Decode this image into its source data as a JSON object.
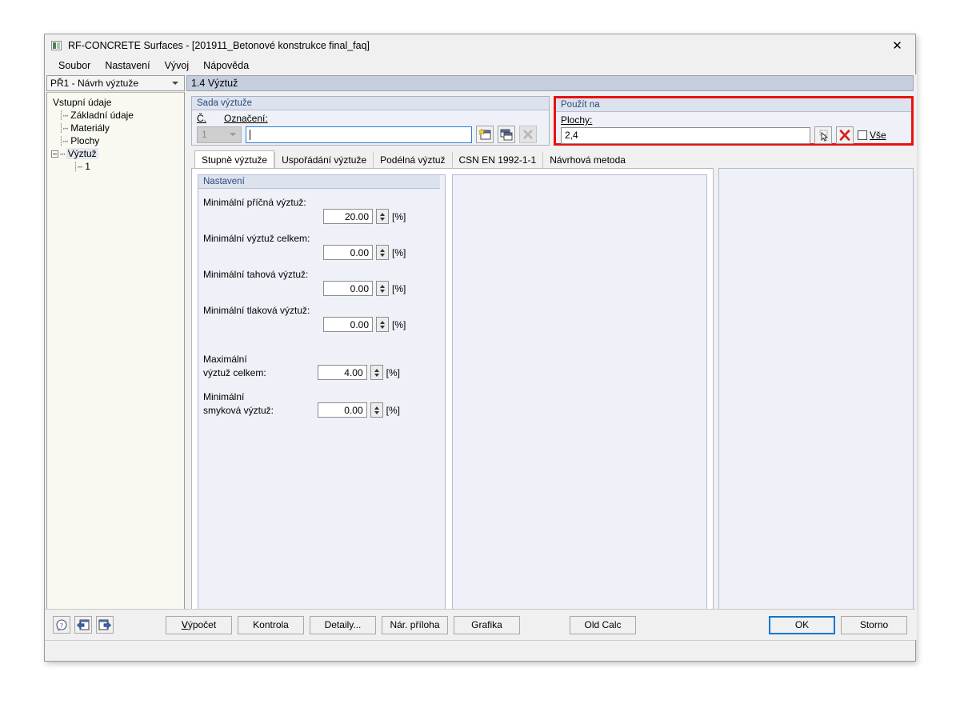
{
  "window": {
    "title": "RF-CONCRETE Surfaces - [201911_Betonové konstrukce final_faq]",
    "app_icon": "application-icon",
    "close_label": "✕"
  },
  "menubar": {
    "items": [
      {
        "label": "Soubor"
      },
      {
        "label": "Nastavení"
      },
      {
        "label": "Vývoj"
      },
      {
        "label": "Nápověda"
      }
    ]
  },
  "sidebar": {
    "combo_value": "PŘ1 - Návrh výztuže",
    "tree": [
      {
        "label": "Vstupní údaje",
        "indent": 0,
        "selected": false,
        "expander": false,
        "dash": false
      },
      {
        "label": "Základní údaje",
        "indent": 1,
        "selected": false,
        "expander": false,
        "dash": true
      },
      {
        "label": "Materiály",
        "indent": 1,
        "selected": false,
        "expander": false,
        "dash": true
      },
      {
        "label": "Plochy",
        "indent": 1,
        "selected": false,
        "expander": false,
        "dash": true
      },
      {
        "label": "Výztuž",
        "indent": 1,
        "selected": true,
        "expander": true,
        "dash": true
      },
      {
        "label": "1",
        "indent": 2,
        "selected": false,
        "expander": false,
        "dash": true
      }
    ]
  },
  "section": {
    "header": "1.4 Výztuž"
  },
  "sada": {
    "title": "Sada výztuže",
    "number_label": "Č.",
    "number_value": "1",
    "name_label": "Označení:",
    "name_value": "",
    "name_placeholder": "",
    "buttons": [
      {
        "name": "new-reinforcement-set-button",
        "icon": "new-window-icon"
      },
      {
        "name": "copy-reinforcement-set-button",
        "icon": "copy-window-icon"
      },
      {
        "name": "delete-reinforcement-set-button",
        "icon": "delete-x-icon"
      }
    ]
  },
  "pouzit": {
    "title": "Použít na",
    "surfaces_label": "Plochy:",
    "surfaces_value": "2,4",
    "pick_icon": "pick-pointer-icon",
    "clear_icon": "red-x-icon",
    "all_checkbox_label": "Vše",
    "all_checkbox_checked": false,
    "highlight_color": "#e81111"
  },
  "tabs": [
    {
      "label": "Stupně výztuže",
      "active": true
    },
    {
      "label": "Uspořádání výztuže",
      "active": false
    },
    {
      "label": "Podélná výztuž",
      "active": false
    },
    {
      "label": "CSN EN 1992-1-1",
      "active": false
    },
    {
      "label": "Návrhová metoda",
      "active": false
    }
  ],
  "settings": {
    "title": "Nastavení",
    "fields": [
      {
        "label": "Minimální příčná výztuž:",
        "label2": "",
        "value": "20.00",
        "unit": "[%]"
      },
      {
        "label": "Minimální výztuž celkem:",
        "label2": "",
        "value": "0.00",
        "unit": "[%]"
      },
      {
        "label": "Minimální tahová výztuž:",
        "label2": "",
        "value": "0.00",
        "unit": "[%]"
      },
      {
        "label": "Minimální tlaková výztuž:",
        "label2": "",
        "value": "0.00",
        "unit": "[%]"
      },
      {
        "label": "Maximální",
        "label2": "výztuž celkem:",
        "value": "4.00",
        "unit": "[%]"
      },
      {
        "label": "Minimální",
        "label2": "smyková výztuž:",
        "value": "0.00",
        "unit": "[%]"
      }
    ]
  },
  "graphic_panel": {
    "tool_icons": [
      {
        "name": "render-view-icon"
      },
      {
        "name": "render-view-alt-icon"
      }
    ]
  },
  "bottombar": {
    "icons": [
      {
        "name": "help-icon"
      },
      {
        "name": "previous-module-icon"
      },
      {
        "name": "next-module-icon"
      }
    ],
    "buttons": [
      {
        "label": "Výpočet",
        "name": "calculate-button",
        "primary": false
      },
      {
        "label": "Kontrola",
        "name": "check-button",
        "primary": false
      },
      {
        "label": "Detaily...",
        "name": "details-button",
        "primary": false
      },
      {
        "label": "Nár. příloha",
        "name": "national-annex-button",
        "primary": false
      },
      {
        "label": "Grafika",
        "name": "graphics-button",
        "primary": false
      }
    ],
    "old_calc_label": "Old Calc",
    "ok_label": "OK",
    "cancel_label": "Storno"
  }
}
